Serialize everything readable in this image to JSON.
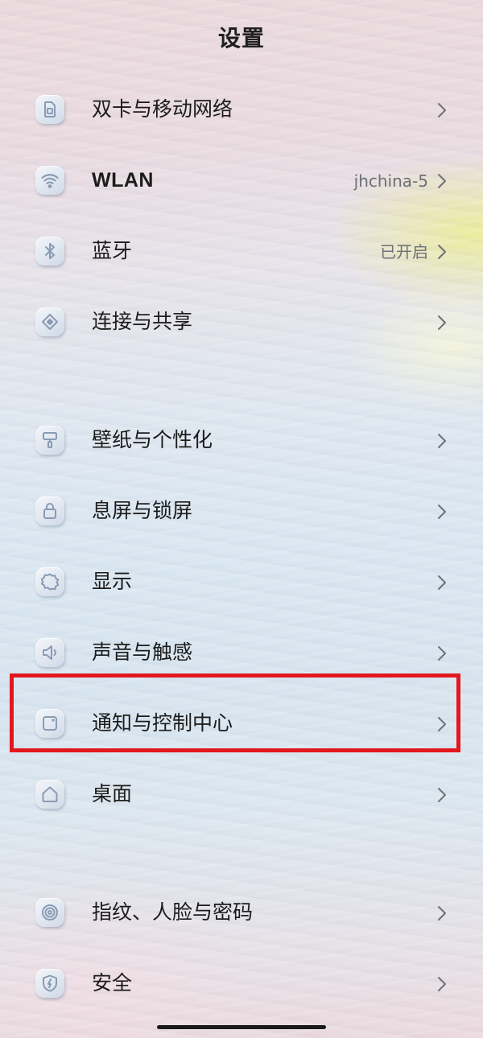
{
  "header": {
    "title": "设置"
  },
  "settings": [
    {
      "key": "sim",
      "label": "双卡与移动网络",
      "icon": "sim-card-icon",
      "value": ""
    },
    {
      "key": "wlan",
      "label": "WLAN",
      "icon": "wifi-icon",
      "value": "jhchina-5"
    },
    {
      "key": "bluetooth",
      "label": "蓝牙",
      "icon": "bluetooth-icon",
      "value": "已开启"
    },
    {
      "key": "sharing",
      "label": "连接与共享",
      "icon": "connection-share-icon",
      "value": ""
    },
    {
      "key": "wallpaper",
      "label": "壁纸与个性化",
      "icon": "paint-roller-icon",
      "value": ""
    },
    {
      "key": "lockscreen",
      "label": "息屏与锁屏",
      "icon": "lock-icon",
      "value": ""
    },
    {
      "key": "display",
      "label": "显示",
      "icon": "brightness-icon",
      "value": ""
    },
    {
      "key": "sound",
      "label": "声音与触感",
      "icon": "speaker-icon",
      "value": ""
    },
    {
      "key": "notifications",
      "label": "通知与控制中心",
      "icon": "notification-icon",
      "value": "",
      "highlighted": true
    },
    {
      "key": "home",
      "label": "桌面",
      "icon": "home-icon",
      "value": ""
    },
    {
      "key": "fingerprint",
      "label": "指纹、人脸与密码",
      "icon": "fingerprint-icon",
      "value": ""
    },
    {
      "key": "security",
      "label": "安全",
      "icon": "shield-icon",
      "value": ""
    }
  ],
  "colors": {
    "highlight_border": "#e3171e",
    "text_primary": "#1c1c1c",
    "text_secondary": "#6c6f76",
    "icon_stroke": "#8a9bb5"
  }
}
